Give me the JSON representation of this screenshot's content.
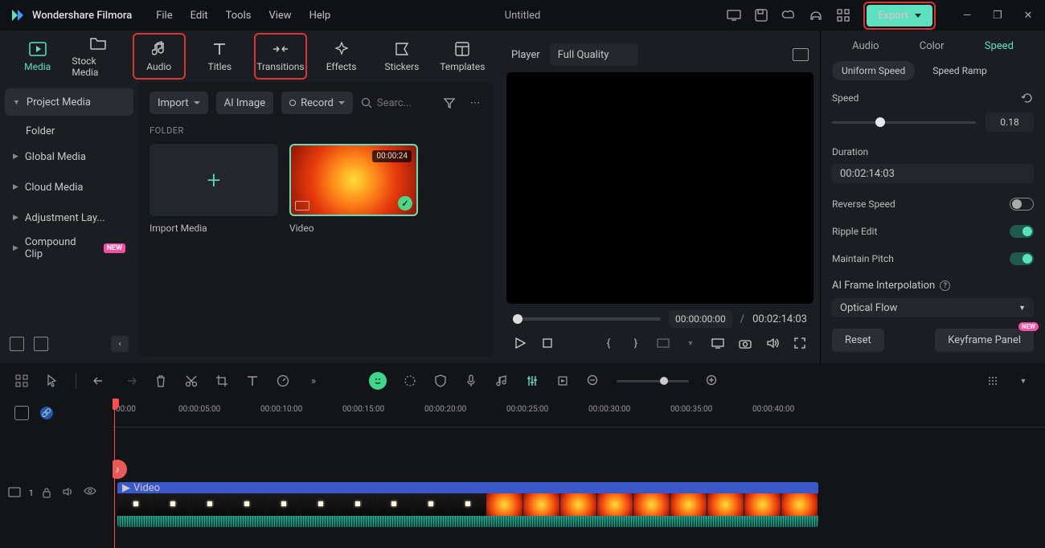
{
  "app": {
    "name": "Wondershare Filmora",
    "title": "Untitled"
  },
  "menu": {
    "file": "File",
    "edit": "Edit",
    "tools": "Tools",
    "view": "View",
    "help": "Help"
  },
  "export_label": "Export",
  "tool_tabs": {
    "media": "Media",
    "stock": "Stock Media",
    "audio": "Audio",
    "titles": "Titles",
    "transitions": "Transitions",
    "effects": "Effects",
    "stickers": "Stickers",
    "templates": "Templates"
  },
  "sidebar": {
    "project": "Project Media",
    "folder": "Folder",
    "global": "Global Media",
    "cloud": "Cloud Media",
    "adjustment": "Adjustment Lay...",
    "compound": "Compound Clip",
    "new": "NEW"
  },
  "media": {
    "import": "Import",
    "ai_image": "AI Image",
    "record": "Record",
    "search_ph": "Searc...",
    "folder_label": "FOLDER",
    "import_media": "Import Media",
    "video_name": "Video",
    "video_dur": "00:00:24"
  },
  "preview": {
    "player": "Player",
    "quality": "Full Quality",
    "tc_current": "00:00:00:00",
    "tc_total": "00:02:14:03"
  },
  "right": {
    "audio": "Audio",
    "color": "Color",
    "speed": "Speed",
    "uniform": "Uniform Speed",
    "ramp": "Speed Ramp",
    "speed_label": "Speed",
    "speed_val": "0.18",
    "duration_label": "Duration",
    "duration_val": "00:02:14:03",
    "reverse": "Reverse Speed",
    "ripple": "Ripple Edit",
    "pitch": "Maintain Pitch",
    "ai_frame": "AI Frame Interpolation",
    "optical": "Optical Flow",
    "reset": "Reset",
    "keyframe": "Keyframe Panel",
    "new": "NEW"
  },
  "timeline": {
    "ticks": [
      "00:00",
      "00:00:05:00",
      "00:00:10:00",
      "00:00:15:00",
      "00:00:20:00",
      "00:00:25:00",
      "00:00:30:00",
      "00:00:35:00",
      "00:00:40:00"
    ],
    "clip_label": "Video",
    "track_num": "1"
  }
}
